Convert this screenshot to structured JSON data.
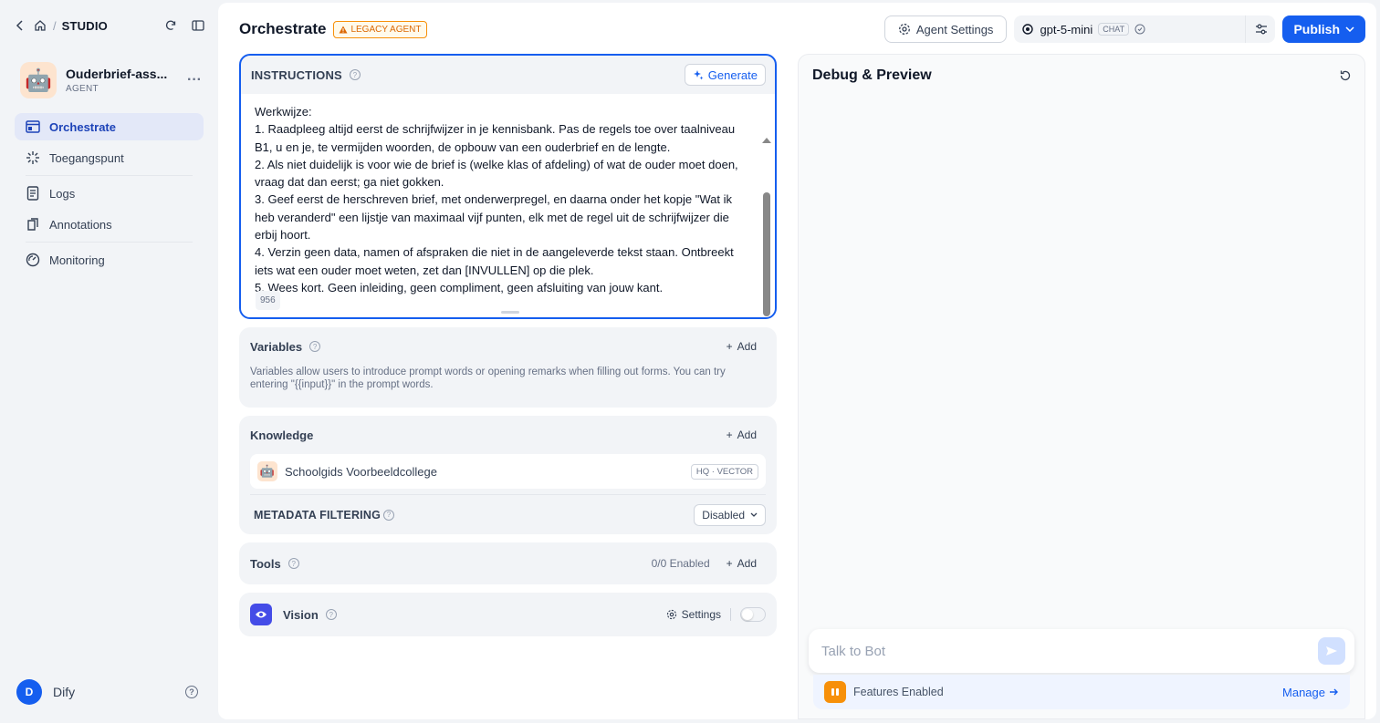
{
  "sidebar": {
    "workspace": "STUDIO",
    "app": {
      "name": "Ouderbrief-ass...",
      "type": "AGENT",
      "avatar": "🤖"
    },
    "nav": [
      {
        "label": "Orchestrate",
        "icon": "orchestrate-icon",
        "active": true
      },
      {
        "label": "Toegangspunt",
        "icon": "access-point-icon"
      },
      {
        "label": "Logs",
        "icon": "logs-icon"
      },
      {
        "label": "Annotations",
        "icon": "annotations-icon"
      },
      {
        "label": "Monitoring",
        "icon": "monitoring-icon"
      }
    ],
    "user": {
      "initial": "D",
      "name": "Dify"
    }
  },
  "header": {
    "title": "Orchestrate",
    "badge": "LEGACY AGENT",
    "agent_settings": "Agent Settings",
    "model": {
      "name": "gpt-5-mini",
      "mode": "CHAT"
    },
    "publish": "Publish"
  },
  "instructions": {
    "title": "INSTRUCTIONS",
    "generate": "Generate",
    "lines": [
      "Werkwijze:",
      "1. Raadpleeg altijd eerst de schrijfwijzer in je kennisbank. Pas de regels toe over taalniveau B1, u en je, te vermijden woorden, de opbouw van een ouderbrief en de lengte.",
      "2. Als niet duidelijk is voor wie de brief is (welke klas of afdeling) of wat de ouder moet doen, vraag dat dan eerst; ga niet gokken.",
      "3. Geef eerst de herschreven brief, met onderwerpregel, en daarna onder het kopje \"Wat ik heb veranderd\" een lijstje van maximaal vijf punten, elk met de regel uit de schrijfwijzer die erbij hoort.",
      "4. Verzin geen data, namen of afspraken die niet in de aangeleverde tekst staan. Ontbreekt iets wat een ouder moet weten, zet dan [INVULLEN] op die plek.",
      "5. Wees kort. Geen inleiding, geen compliment, geen afsluiting van jouw kant."
    ],
    "char_count": "956"
  },
  "variables": {
    "title": "Variables",
    "add": "Add",
    "description": "Variables allow users to introduce prompt words or opening remarks when filling out forms. You can try entering \"{{input}}\" in the prompt words."
  },
  "knowledge": {
    "title": "Knowledge",
    "add": "Add",
    "items": [
      {
        "name": "Schoolgids Voorbeeldcollege",
        "badge": "HQ · VECTOR",
        "icon": "🤖"
      }
    ],
    "metadata_filtering": {
      "label": "METADATA FILTERING",
      "value": "Disabled"
    }
  },
  "tools": {
    "title": "Tools",
    "enabled": "0/0 Enabled",
    "add": "Add"
  },
  "vision": {
    "title": "Vision",
    "settings": "Settings",
    "enabled": false
  },
  "debug": {
    "title": "Debug & Preview",
    "input_placeholder": "Talk to Bot",
    "features": "Features Enabled",
    "manage": "Manage"
  }
}
